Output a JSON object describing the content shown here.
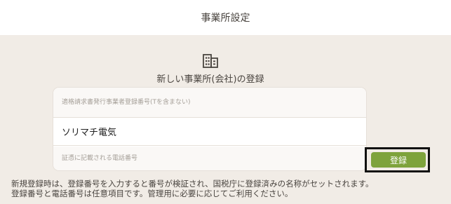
{
  "header": {
    "title": "事業所設定"
  },
  "section": {
    "icon": "building-icon",
    "subtitle": "新しい事業所(会社)の登録"
  },
  "form": {
    "registration_number": {
      "value": "",
      "placeholder": "適格請求書発行事業者登録番号(Tを含まない)"
    },
    "company_name": {
      "value": "ソリマチ電気"
    },
    "phone_number": {
      "value": "",
      "placeholder": "証憑に記載される電話番号"
    }
  },
  "actions": {
    "register_label": "登録",
    "register_color": "#7ea33c"
  },
  "notes": {
    "line1": "新規登録時は、登録番号を入力すると番号が検証され、国税庁に登録済みの名称がセットされます。",
    "line2": "登録番号と電話番号は任意項目です。管理用に必要に応じてご利用ください。"
  }
}
